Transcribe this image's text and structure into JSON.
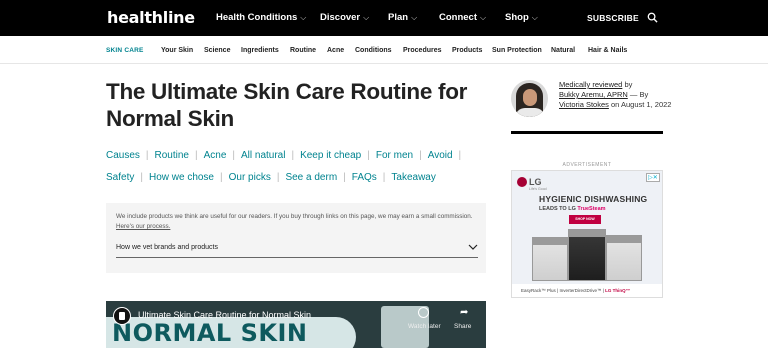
{
  "header": {
    "logo": "healthline",
    "nav": [
      {
        "label": "Health Conditions",
        "chevron": "⌵"
      },
      {
        "label": "Discover",
        "chevron": "⌵"
      },
      {
        "label": "Plan",
        "chevron": "⌵"
      },
      {
        "label": "Connect",
        "chevron": "⌵"
      },
      {
        "label": "Shop",
        "chevron": "⌵"
      }
    ],
    "subscribe": "SUBSCRIBE",
    "search_icon": "search-icon"
  },
  "subnav": {
    "active": "SKIN CARE",
    "items": [
      "Your Skin",
      "Science",
      "Ingredients",
      "Routine",
      "Acne",
      "Conditions",
      "Procedures",
      "Products",
      "Sun Protection",
      "Natural",
      "Hair & Nails"
    ]
  },
  "article": {
    "title": "The Ultimate Skin Care Routine for Normal Skin",
    "anchors_row1": [
      "Causes",
      "Routine",
      "Acne",
      "All natural",
      "Keep it cheap",
      "For men",
      "Avoid"
    ],
    "anchors_row2": [
      "Safety",
      "How we chose",
      "Our picks",
      "See a derm",
      "FAQs",
      "Takeaway"
    ]
  },
  "disclaimer": {
    "text": "We include products we think are useful for our readers. If you buy through links on this page, we may earn a small commission.",
    "link": "Here's our process.",
    "vet_label": "How we vet brands and products"
  },
  "video": {
    "title": "Ultimate Skin Care Routine for Normal Skin",
    "banner": "NORMAL SKIN",
    "watch_later": "Watch later",
    "share": "Share",
    "product_label": "Aveeno"
  },
  "byline": {
    "prefix": "Medically reviewed",
    "by": "by",
    "reviewer": "Bukky Aremu, APRN",
    "dash_by": "— By",
    "author": "Victoria Stokes",
    "date": "on August 1, 2022"
  },
  "ad": {
    "label": "ADVERTISEMENT",
    "brand": "LG",
    "brand_sub": "Life's Good",
    "headline": "HYGIENIC DISHWASHING",
    "subhead": "LEADS TO LG",
    "subhead_trail": "TrueSteam",
    "cta": "SHOP NOW",
    "footer_1": "EasyRack™ Plus",
    "footer_2": "InverterDirectDrive™",
    "footer_3": "LG ThinQ™",
    "adchoices": "▷✕",
    "colors": {
      "lg_red": "#a50034",
      "cta": "#c00040"
    }
  },
  "colors": {
    "accent": "#00838f",
    "topbar": "#000000"
  }
}
